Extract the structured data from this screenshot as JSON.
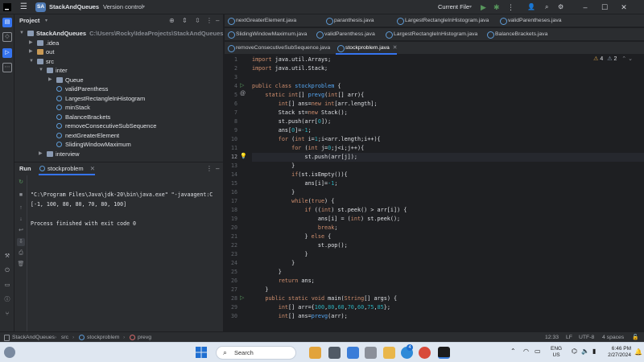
{
  "titlebar": {
    "project_badge": "SA",
    "project_name": "StackAndQueues",
    "version_control": "Version control",
    "run_config": "Current File",
    "icons": [
      "hamburger-icon",
      "chevron-down-icon",
      "run-icon",
      "debug-icon",
      "more-icon",
      "people-icon",
      "search-icon",
      "settings-icon",
      "minimize-icon",
      "maximize-icon",
      "close-icon"
    ]
  },
  "project_panel": {
    "title": "Project",
    "tree": [
      {
        "level": 0,
        "arrow": "down",
        "icon": "folder",
        "label": "StackAndQueues",
        "path": "C:\\Users\\Rocky\\IdeaProjects\\StackAndQueues"
      },
      {
        "level": 1,
        "arrow": "right",
        "icon": "folder",
        "label": ".idea"
      },
      {
        "level": 1,
        "arrow": "right",
        "icon": "folder-orange",
        "label": "out"
      },
      {
        "level": 1,
        "arrow": "down",
        "icon": "folder",
        "label": "src"
      },
      {
        "level": 2,
        "arrow": "down",
        "icon": "folder",
        "label": "inter"
      },
      {
        "level": 3,
        "arrow": "right",
        "icon": "folder",
        "label": "Queue"
      },
      {
        "level": 3,
        "arrow": "",
        "icon": "class",
        "label": "validParenthess"
      },
      {
        "level": 3,
        "arrow": "",
        "icon": "class",
        "label": "LargestRectangleInHistogram"
      },
      {
        "level": 3,
        "arrow": "",
        "icon": "class",
        "label": "minStack"
      },
      {
        "level": 3,
        "arrow": "",
        "icon": "class",
        "label": "BalanceBrackets"
      },
      {
        "level": 3,
        "arrow": "",
        "icon": "class",
        "label": "removeConsecutiveSubSequence"
      },
      {
        "level": 3,
        "arrow": "",
        "icon": "class",
        "label": "nextGreaterElement"
      },
      {
        "level": 3,
        "arrow": "",
        "icon": "class",
        "label": "SlidingWindowMaximum"
      },
      {
        "level": 2,
        "arrow": "right",
        "icon": "folder",
        "label": "interview"
      }
    ]
  },
  "run_panel": {
    "tab_run": "Run",
    "tab_config": "stockproblem",
    "console": [
      "\"C:\\Program Files\\Java\\jdk-20\\bin\\java.exe\" \"-javaagent:C",
      "[-1, 100, 80, 80, 70, 80, 100]",
      "",
      "Process finished with exit code 0"
    ]
  },
  "editor": {
    "tabs_row1": [
      "nextGreaterElement.java",
      "paranthesis.java",
      "LargestRectangleInHistogram.java",
      "validParentheses.java"
    ],
    "tabs_row2": [
      "SlidingWindowMaximum.java",
      "validParenthess.java",
      "LargestRectangleInHistogram.java",
      "BalanceBrackets.java"
    ],
    "tabs_row3": [
      "removeConsecutiveSubSequence.java",
      "stockproblem.java"
    ],
    "active_tab": "stockproblem.java",
    "warnings": "4",
    "weak_warnings": "2",
    "line_numbers": [
      "1",
      "2",
      "3",
      "4",
      "5",
      "6",
      "7",
      "8",
      "9",
      "10",
      "11",
      "12",
      "13",
      "14",
      "15",
      "16",
      "17",
      "18",
      "19",
      "20",
      "21",
      "22",
      "23",
      "24",
      "25",
      "26",
      "27",
      "28",
      "29",
      "30"
    ],
    "code": [
      "import java.util.Arrays;",
      "import java.util.Stack;",
      "",
      "public class stockproblem {",
      "    static int[] prevg(int[] arr){",
      "        int[] ans=new int[arr.length];",
      "        Stack st=new Stack();",
      "        st.push(arr[0]);",
      "        ans[0]=-1;",
      "        for (int i=1;i<arr.length;i++){",
      "            for (int j=0;j<i;j++){",
      "                st.push(arr[j]);",
      "            }",
      "            if(st.isEmpty()){",
      "                ans[i]=-1;",
      "            }",
      "            while(true) {",
      "                if ((int) st.peek() > arr[i]) {",
      "                    ans[i] = (int) st.peek();",
      "                    break;",
      "                } else {",
      "                    st.pop();",
      "                }",
      "            }",
      "        }",
      "        return ans;",
      "    }",
      "    public static void main(String[] args) {",
      "        int[] arr={100,80,60,70,60,75,85};",
      "        int[] ans=prevg(arr);"
    ]
  },
  "statusbar": {
    "breadcrumb": [
      "StackAndQueues",
      "src",
      "stockproblem",
      "prevg"
    ],
    "position": "12:33",
    "line_sep": "LF",
    "encoding": "UTF-8",
    "indent": "4 spaces"
  },
  "taskbar": {
    "search_placeholder": "Search",
    "lang": "ENG",
    "region": "US",
    "time": "6:46 PM",
    "date": "2/27/2024",
    "badge": "4"
  }
}
